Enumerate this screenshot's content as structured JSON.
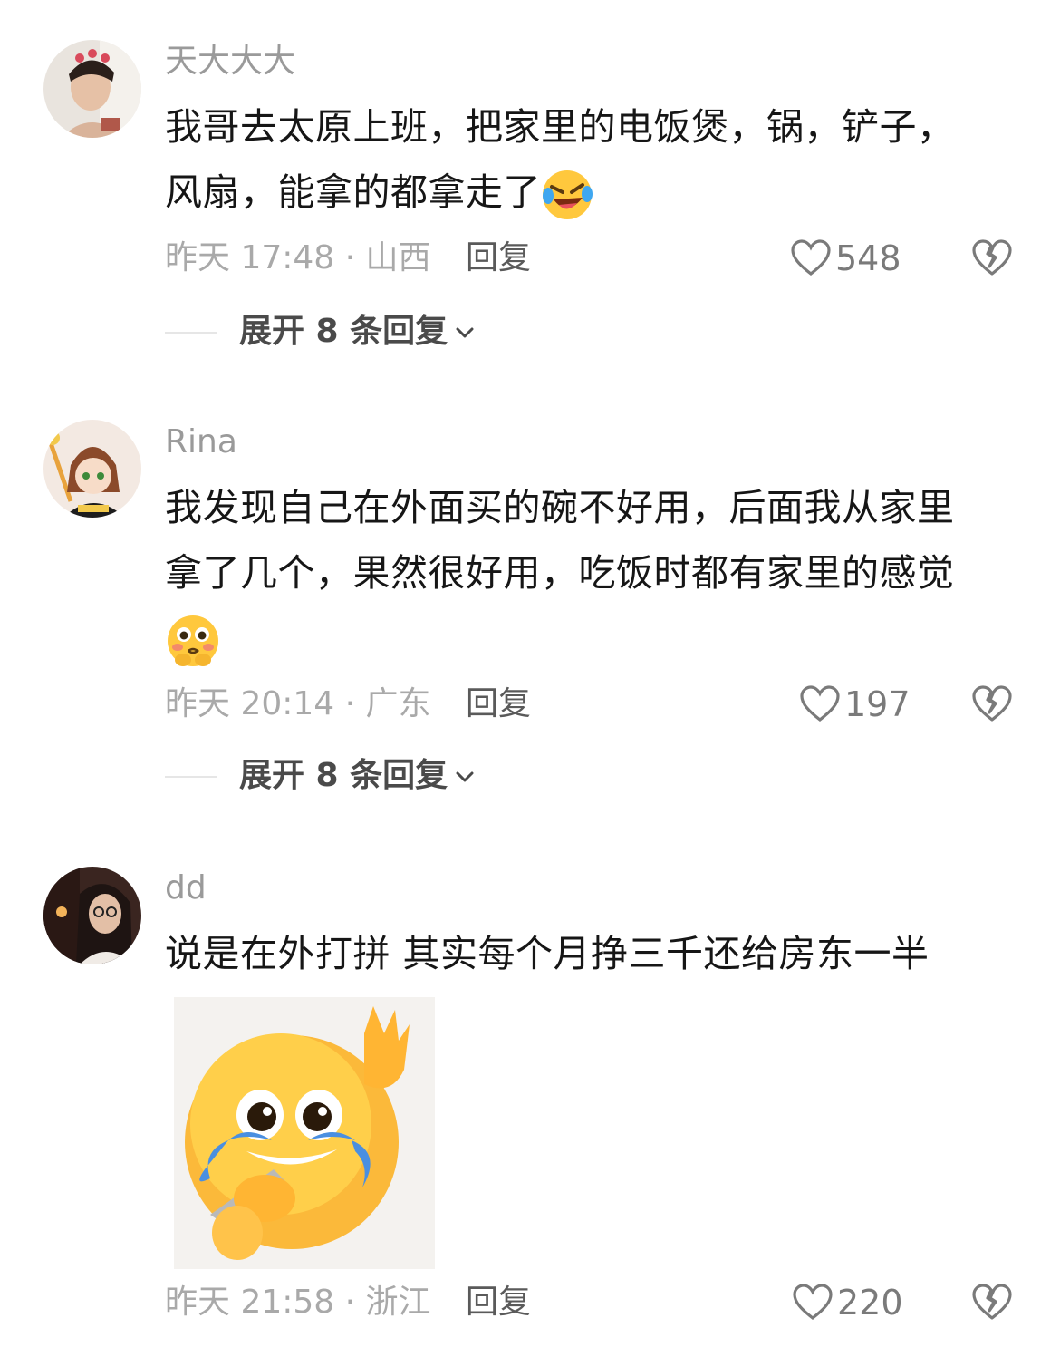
{
  "comments": [
    {
      "username": "天大大大",
      "text_line1": "我哥去太原上班，把家里的电饭煲，锅，铲子，",
      "text_line2": "风扇，能拿的都拿走了",
      "inline_emoji": "laughing-crying-emoji",
      "time_location": "昨天 17:48 · 山西",
      "reply_label": "回复",
      "likes": "548",
      "expand_label": "展开 8 条回复"
    },
    {
      "username": "Rina",
      "text_line1": "我发现自己在外面买的碗不好用，后面我从家里",
      "text_line2": "拿了几个，果然很好用，吃饭时都有家里的感觉",
      "inline_emoji": "flushed-pleading-emoji",
      "time_location": "昨天 20:14 · 广东",
      "reply_label": "回复",
      "likes": "197",
      "expand_label": "展开 8 条回复"
    },
    {
      "username": "dd",
      "text_line1": "说是在外打拼 其实每个月挣三千还给房东一半",
      "sticker": "crying-smile-gun-sticker",
      "time_location": "昨天 21:58 · 浙江",
      "reply_label": "回复",
      "likes": "220"
    }
  ],
  "colors": {
    "username": "#9a9a9a",
    "meta": "#a9a9a9",
    "reply": "#5a5a5a",
    "emoji_yellow": "#ffc83d"
  }
}
